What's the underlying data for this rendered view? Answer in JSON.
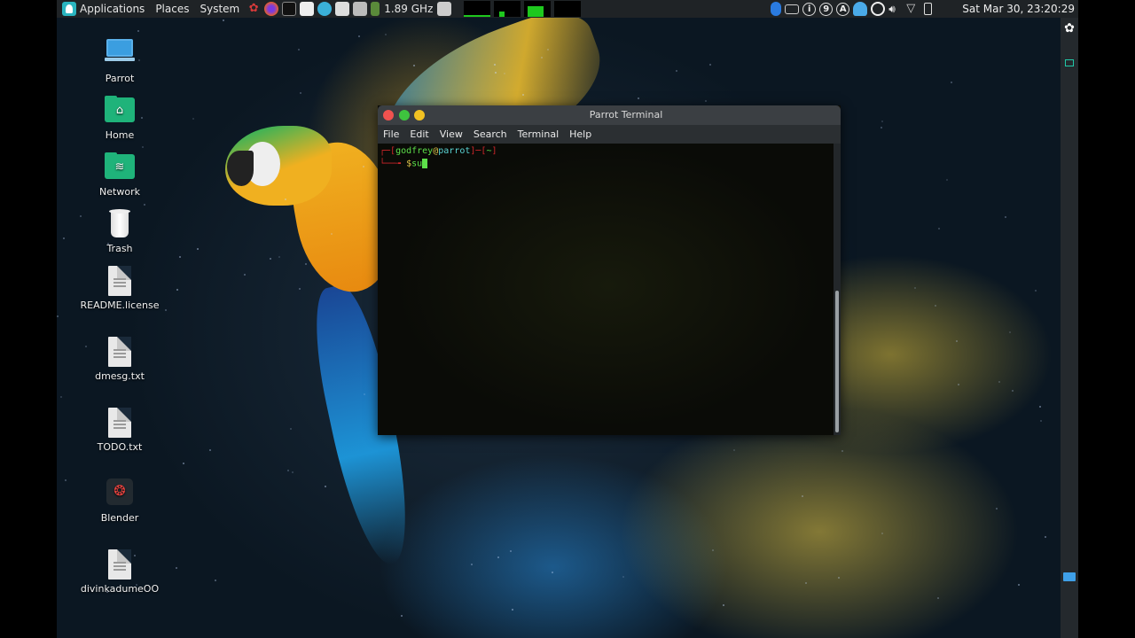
{
  "top_panel": {
    "applications_label": "Applications",
    "places_label": "Places",
    "system_label": "System",
    "cpu_freq": "1.89 GHz",
    "clock": "Sat Mar 30, 23:20:29",
    "tray_badges": [
      "i",
      "9",
      "A"
    ]
  },
  "desktop_icons": [
    {
      "label": "Parrot",
      "icon": "computer-icon"
    },
    {
      "label": "Home",
      "icon": "home-folder-icon"
    },
    {
      "label": "Network",
      "icon": "network-folder-icon"
    },
    {
      "label": "Trash",
      "icon": "trash-icon"
    },
    {
      "label": "README.license",
      "icon": "text-file-icon"
    },
    {
      "label": "dmesg.txt",
      "icon": "text-file-icon"
    },
    {
      "label": "TODO.txt",
      "icon": "text-file-icon"
    },
    {
      "label": "Blender",
      "icon": "blender-icon"
    },
    {
      "label": "divinkadumeOO",
      "icon": "text-file-icon"
    }
  ],
  "terminal": {
    "title": "Parrot Terminal",
    "menu": [
      "File",
      "Edit",
      "View",
      "Search",
      "Terminal",
      "Help"
    ],
    "prompt_user": "godfrey",
    "prompt_at": "@",
    "prompt_host": "parrot",
    "prompt_dir": "~",
    "input": "su"
  },
  "colors": {
    "panel_bg": "#1f2326",
    "accent_teal": "#2ab5c0",
    "folder_green": "#1fb37a",
    "terminal_green": "#5de04a",
    "terminal_red": "#d0262a"
  }
}
